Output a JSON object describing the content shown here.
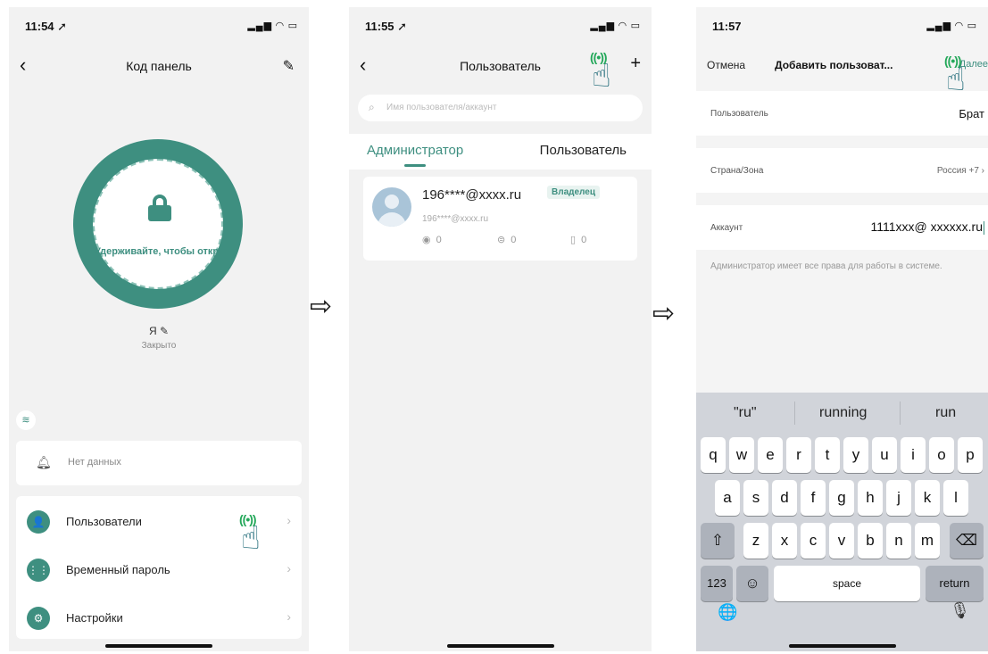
{
  "screen1": {
    "status": {
      "time": "11:54 ➚",
      "signal": "▂▄▆ ◠ ▭"
    },
    "nav": {
      "title": "Код панель",
      "back": "‹",
      "edit": "✎"
    },
    "ring_text": "Удерживайте, чтобы открыть",
    "user_label": "Я ✎",
    "lock_state": "Закрыто",
    "no_data": "Нет данных",
    "menu": [
      {
        "label": "Пользователи",
        "icon": "user-icon",
        "glyph": "👤"
      },
      {
        "label": "Временный пароль",
        "icon": "keypad-icon",
        "glyph": "⋮⋮"
      },
      {
        "label": "Настройки",
        "icon": "settings-icon",
        "glyph": "⚙"
      }
    ],
    "chevron": "›"
  },
  "screen2": {
    "status": {
      "time": "11:55 ➚",
      "signal": "▂▄▆ ◠ ▭"
    },
    "nav": {
      "title": "Пользователь",
      "back": "‹",
      "add": "+"
    },
    "search_placeholder": "Имя пользователя/аккаунт",
    "tabs": {
      "admin": "Администратор",
      "user": "Пользователь"
    },
    "user": {
      "name": "196****@xxxx.ru",
      "badge": "Владелец",
      "sub": "196****@xxxx.ru",
      "fingerprint_count": "0",
      "card_count": "0",
      "password_count": "0"
    }
  },
  "screen3": {
    "status": {
      "time": "11:57",
      "signal": "▂▄▆ ◠ ▭"
    },
    "nav": {
      "cancel": "Отмена",
      "title": "Добавить пользоват...",
      "next": "Далее"
    },
    "rows": {
      "user_label": "Пользователь",
      "user_value": "Брат",
      "country_label": "Страна/Зона",
      "country_value": "Россия +7 ›",
      "account_label": "Аккаунт",
      "account_value": "1111xxx@ xxxxxx.ru"
    },
    "hint": "Администратор имеет все права для работы в системе.",
    "keyboard": {
      "suggestions": [
        "\"ru\"",
        "running",
        "run"
      ],
      "row1": [
        "q",
        "w",
        "e",
        "r",
        "t",
        "y",
        "u",
        "i",
        "o",
        "p"
      ],
      "row2": [
        "a",
        "s",
        "d",
        "f",
        "g",
        "h",
        "j",
        "k",
        "l"
      ],
      "row3": [
        "z",
        "x",
        "c",
        "v",
        "b",
        "n",
        "m"
      ],
      "shift": "⇧",
      "delete": "⌫",
      "numbers": "123",
      "emoji": "☺",
      "space": "space",
      "return": "return",
      "globe": "🌐",
      "mic": "🎙"
    }
  },
  "colors": {
    "accent": "#3e8f80",
    "hand": "#1f6a78",
    "tap": "#24a85a"
  },
  "arrow": "⇨",
  "tap_glyph": "☝",
  "tap_waves": "((•))"
}
